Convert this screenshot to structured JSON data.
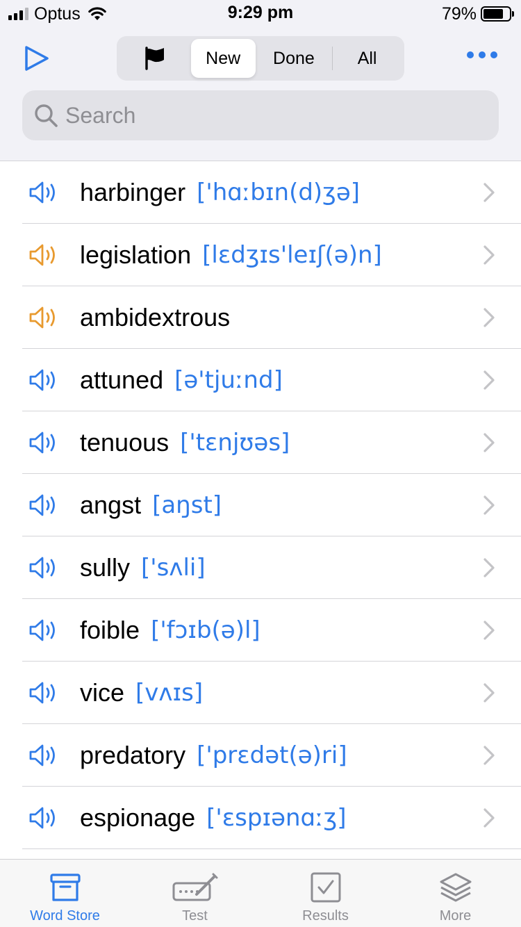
{
  "status_bar": {
    "carrier": "Optus",
    "time": "9:29 pm",
    "battery": "79%",
    "battery_level": 0.79
  },
  "toolbar": {
    "segments": {
      "flag_icon": "flag-icon",
      "new": "New",
      "done": "Done",
      "all": "All"
    },
    "selected_segment": "New",
    "search_placeholder": "Search"
  },
  "colors": {
    "accent": "#2f7be8",
    "speaker_orange": "#e89a2f",
    "chevron": "#c4c4c7"
  },
  "words": [
    {
      "word": "harbinger",
      "phonetic": "['hɑːbɪn(d)ʒə]",
      "speaker": "blue"
    },
    {
      "word": "legislation",
      "phonetic": "[lɛdʒɪs'leɪʃ(ə)n]",
      "speaker": "orange"
    },
    {
      "word": "ambidextrous",
      "phonetic": "",
      "speaker": "orange"
    },
    {
      "word": "attuned",
      "phonetic": "[ə'tjuːnd]",
      "speaker": "blue"
    },
    {
      "word": "tenuous",
      "phonetic": "['tɛnjʊəs]",
      "speaker": "blue"
    },
    {
      "word": "angst",
      "phonetic": "[aŋst]",
      "speaker": "blue"
    },
    {
      "word": "sully",
      "phonetic": "['sʌli]",
      "speaker": "blue"
    },
    {
      "word": "foible",
      "phonetic": "['fɔɪb(ə)l]",
      "speaker": "blue"
    },
    {
      "word": "vice",
      "phonetic": "[vʌɪs]",
      "speaker": "blue"
    },
    {
      "word": "predatory",
      "phonetic": "['prɛdət(ə)ri]",
      "speaker": "blue"
    },
    {
      "word": "espionage",
      "phonetic": "['ɛspɪənɑːʒ]",
      "speaker": "blue"
    },
    {
      "word": "",
      "phonetic": "",
      "speaker": "blue"
    }
  ],
  "tab_bar": {
    "tabs": [
      {
        "label": "Word Store",
        "icon": "archive-box-icon",
        "active": true
      },
      {
        "label": "Test",
        "icon": "keyboard-pencil-icon",
        "active": false
      },
      {
        "label": "Results",
        "icon": "checkbox-icon",
        "active": false
      },
      {
        "label": "More",
        "icon": "layers-icon",
        "active": false
      }
    ]
  }
}
